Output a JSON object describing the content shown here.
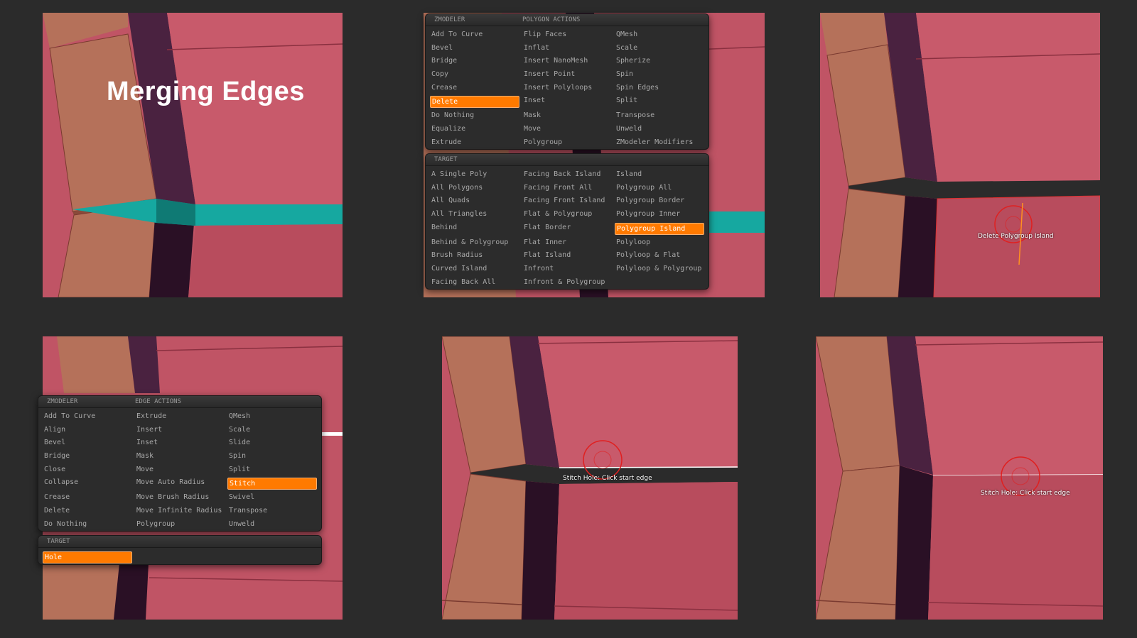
{
  "panel1": {
    "headline": "Merging Edges"
  },
  "polygon_menu": {
    "header_left": "ZMODELER",
    "header_right": "POLYGON ACTIONS",
    "columns": [
      [
        "Add To Curve",
        "Bevel",
        "Bridge",
        "Copy",
        "Crease",
        "Delete",
        "Do Nothing",
        "Equalize",
        "Extrude"
      ],
      [
        "Flip Faces",
        "Inflat",
        "Insert NanoMesh",
        "Insert Point",
        "Insert Polyloops",
        "Inset",
        "Mask",
        "Move",
        "Polygroup"
      ],
      [
        "QMesh",
        "Scale",
        "Spherize",
        "Spin",
        "Spin Edges",
        "Split",
        "Transpose",
        "Unweld",
        "ZModeler Modifiers"
      ]
    ],
    "selected": "Delete",
    "target_header": "TARGET",
    "target_columns": [
      [
        "A Single Poly",
        "All Polygons",
        "All Quads",
        "All Triangles",
        "Behind",
        "Behind & Polygroup",
        "Brush Radius",
        "Curved Island",
        "Facing Back All"
      ],
      [
        "Facing Back Island",
        "Facing Front All",
        "Facing Front Island",
        "Flat & Polygroup",
        "Flat Border",
        "Flat Inner",
        "Flat Island",
        "Infront",
        "Infront & Polygroup"
      ],
      [
        "Island",
        "Polygroup All",
        "Polygroup Border",
        "Polygroup Inner",
        "Polygroup Island",
        "Polyloop",
        "Polyloop & Flat",
        "Polyloop & Polygroup"
      ]
    ],
    "target_selected": "Polygroup Island"
  },
  "panel3": {
    "tooltip": "Delete Polygroup Island"
  },
  "edge_menu": {
    "header_left": "ZMODELER",
    "header_right": "EDGE ACTIONS",
    "columns": [
      [
        "Add To Curve",
        "Align",
        "Bevel",
        "Bridge",
        "Close",
        "Collapse",
        "Crease",
        "Delete",
        "Do Nothing"
      ],
      [
        "Extrude",
        "Insert",
        "Inset",
        "Mask",
        "Move",
        "Move Auto Radius",
        "Move Brush Radius",
        "Move Infinite Radius",
        "Polygroup"
      ],
      [
        "QMesh",
        "Scale",
        "Slide",
        "Spin",
        "Split",
        "Stitch",
        "Swivel",
        "Transpose",
        "Unweld"
      ]
    ],
    "selected": "Stitch",
    "target_header": "TARGET",
    "target_columns": [
      [
        "Hole"
      ]
    ],
    "target_selected": "Hole"
  },
  "panel5": {
    "tooltip": "Stitch Hole: Click start edge"
  },
  "panel6": {
    "tooltip": "Stitch Hole: Click start edge"
  },
  "colors": {
    "background": "#2b2b2b",
    "pink_face": "#c05465",
    "tan_face": "#b5715a",
    "dark_groove": "#3a1a33",
    "teal_edge": "#16a8a0",
    "highlight": "#ff7a00"
  }
}
